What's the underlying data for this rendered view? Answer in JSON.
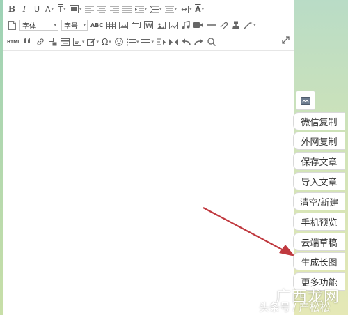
{
  "toolbar": {
    "bold_label": "B",
    "italic_label": "I",
    "underline_label": "U",
    "font_color_label": "A",
    "font_bg_label": "T",
    "font_select_value": "字体",
    "size_select_value": "字号",
    "abc_label": "ABC",
    "html_label": "HTML",
    "omega_label": "Ω",
    "highlight_label": "A"
  },
  "side_panel": {
    "items": [
      {
        "label": "微信复制"
      },
      {
        "label": "外网复制"
      },
      {
        "label": "保存文章"
      },
      {
        "label": "导入文章"
      },
      {
        "label": "清空/新建"
      },
      {
        "label": "手机预览"
      },
      {
        "label": "云端草稿"
      },
      {
        "label": "生成长图"
      },
      {
        "label": "更多功能"
      }
    ]
  },
  "watermark": {
    "logo_text": "广西龙网",
    "sub_text": "头条号 / 产松松"
  },
  "colors": {
    "arrow": "#c0393f",
    "background_top": "#b9dcc6",
    "background_bottom": "#e5e8b6"
  }
}
